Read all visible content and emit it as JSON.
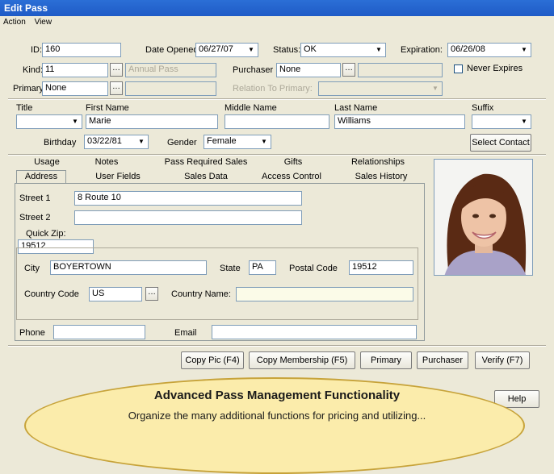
{
  "window": {
    "title": "Edit Pass"
  },
  "menu": [
    "Action",
    "View"
  ],
  "header": {
    "id_label": "ID:",
    "id_value": "160",
    "date_opened_label": "Date Opened:",
    "date_opened_value": "06/27/07",
    "status_label": "Status:",
    "status_value": "OK",
    "expiration_label": "Expiration:",
    "expiration_value": "06/26/08",
    "kind_label": "Kind:",
    "kind_value": "11",
    "kind_name": "Annual Pass",
    "purchaser_label": "Purchaser",
    "purchaser_value": "None",
    "never_expires_label": "Never Expires",
    "primary_label": "Primary",
    "primary_value": "None",
    "relation_label": "Relation To Primary:"
  },
  "person": {
    "title_label": "Title",
    "title_value": "",
    "first_label": "First Name",
    "first_value": "Marie",
    "middle_label": "Middle Name",
    "middle_value": "",
    "last_label": "Last Name",
    "last_value": "Williams",
    "suffix_label": "Suffix",
    "suffix_value": "",
    "birthday_label": "Birthday",
    "birthday_value": "03/22/81",
    "gender_label": "Gender",
    "gender_value": "Female",
    "select_contact": "Select Contact"
  },
  "tabs_row1": [
    "Usage",
    "Notes",
    "Pass Required Sales",
    "Gifts",
    "Relationships"
  ],
  "tabs_row2": [
    "Address",
    "User Fields",
    "Sales Data",
    "Access Control",
    "Sales History"
  ],
  "address": {
    "street1_label": "Street 1",
    "street1_value": "8 Route 10",
    "street2_label": "Street 2",
    "street2_value": "",
    "quickzip_label": "Quick Zip:",
    "quickzip_value": "19512",
    "city_label": "City",
    "city_value": "BOYERTOWN",
    "state_label": "State",
    "state_value": "PA",
    "postal_label": "Postal Code",
    "postal_value": "19512",
    "country_code_label": "Country Code",
    "country_code_value": "US",
    "country_name_label": "Country Name:",
    "country_name_value": "",
    "phone_label": "Phone",
    "phone_value": "",
    "email_label": "Email",
    "email_value": ""
  },
  "buttons": {
    "copy_pic": "Copy Pic (F4)",
    "copy_membership": "Copy Membership (F5)",
    "primary": "Primary",
    "purchaser": "Purchaser",
    "verify": "Verify (F7)",
    "help": "Help"
  },
  "callout": {
    "title": "Advanced Pass Management Functionality",
    "subtitle": "Organize the many additional functions for pricing and utilizing..."
  }
}
